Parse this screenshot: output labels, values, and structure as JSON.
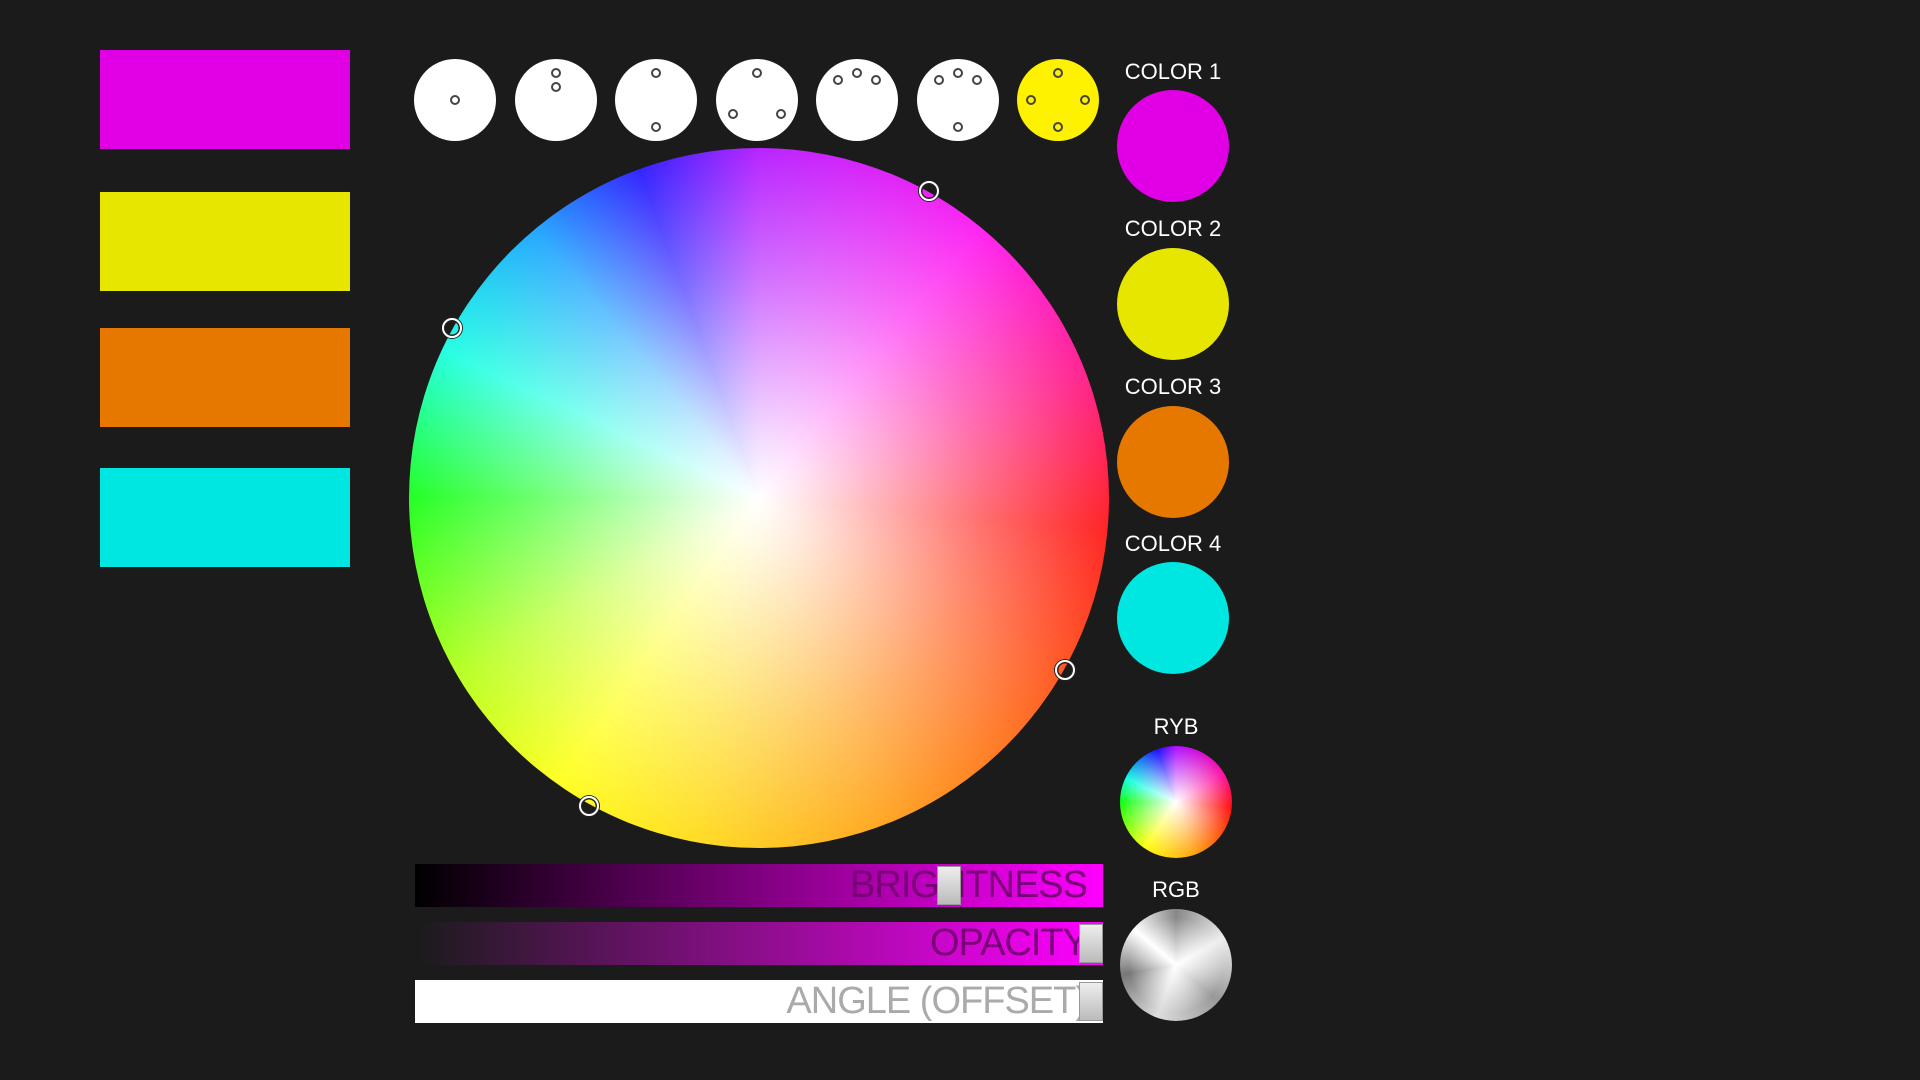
{
  "palette_swatches": [
    {
      "color": "#e100e6"
    },
    {
      "color": "#e6e600"
    },
    {
      "color": "#e67800"
    },
    {
      "color": "#00e6e0"
    }
  ],
  "harmony_modes": [
    {
      "points": 1,
      "selected": false
    },
    {
      "points": 2,
      "selected": false
    },
    {
      "points": 2,
      "selected": false
    },
    {
      "points": 3,
      "selected": false
    },
    {
      "points": 3,
      "selected": false
    },
    {
      "points": 4,
      "selected": false
    },
    {
      "points": 4,
      "selected": true
    }
  ],
  "selected_mode_color": "#fff200",
  "colors": [
    {
      "label": "COLOR 1",
      "color": "#e100e6"
    },
    {
      "label": "COLOR 2",
      "color": "#e6e600"
    },
    {
      "label": "COLOR 3",
      "color": "#e67800"
    },
    {
      "label": "COLOR 4",
      "color": "#00e6e0"
    }
  ],
  "wheel_types": [
    {
      "label": "RYB"
    },
    {
      "label": "RGB"
    }
  ],
  "sliders": {
    "brightness": {
      "label": "BRIGHTNESS",
      "value": 0.77
    },
    "opacity": {
      "label": "OPACITY",
      "value": 1.0
    },
    "angle": {
      "label": "ANGLE (OFFSET)",
      "value": 1.0
    }
  }
}
